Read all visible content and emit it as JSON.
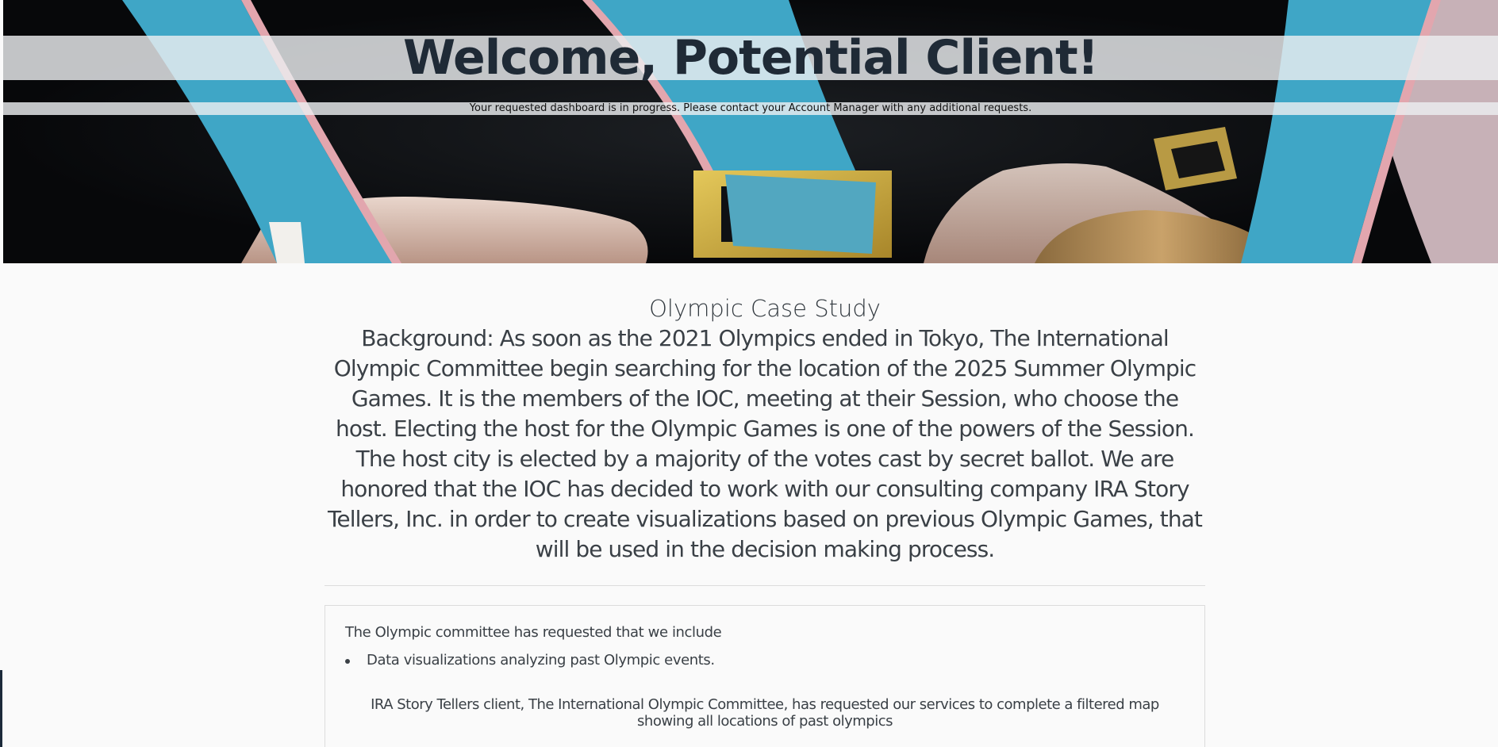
{
  "hero": {
    "title": "Welcome, Potential Client!",
    "subtitle": "Your requested dashboard is in progress. Please contact your Account Manager with any additional requests.",
    "image": "olympic-medals-ribbons-photo"
  },
  "case_study": {
    "title": "Olympic Case Study",
    "background": "Background: As soon as the 2021 Olympics ended in Tokyo, The International Olympic Committee begin searching for the location of the 2025 Summer Olympic Games. It is the members of the IOC, meeting at their Session, who choose the host. Electing the host for the Olympic Games is one of the powers of the Session. The host city is elected by a majority of the votes cast by secret ballot. We are honored that the IOC has decided to work with our consulting company IRA Story Tellers, Inc. in order to create visualizations based on previous Olympic Games, that will be used in the decision making process."
  },
  "card": {
    "intro": "The Olympic committee has requested that we include",
    "items": [
      {
        "label": "Data visualizations analyzing past Olympic events."
      }
    ],
    "paragraph": "IRA Story Tellers client, The International Olympic Committee, has requested our services to complete a filtered map showing all locations of past olympics"
  },
  "colors": {
    "page_background": "#fafafa",
    "title_text": "#1f2a36",
    "body_text": "#3a4046",
    "ribbon_blue": "#3fa6c6",
    "band_overlay": "#ebeef0"
  }
}
